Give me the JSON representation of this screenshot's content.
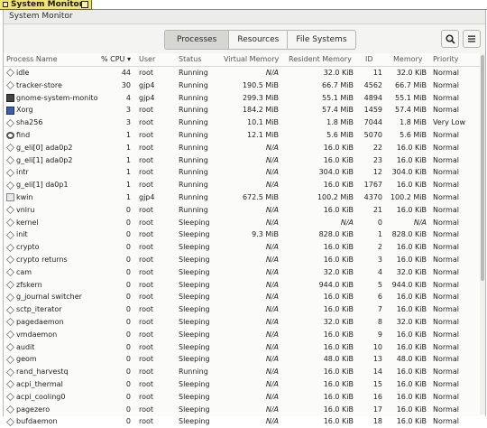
{
  "wm": {
    "title": "System Monitor"
  },
  "window": {
    "title": "System Monitor"
  },
  "tabs": [
    {
      "label": "Processes",
      "active": true
    },
    {
      "label": "Resources",
      "active": false
    },
    {
      "label": "File Systems",
      "active": false
    }
  ],
  "toolbar": {
    "search_icon": "search-icon",
    "menu_icon": "hamburger-menu-icon"
  },
  "columns": {
    "name": "Process Name",
    "cpu": "% CPU",
    "user": "User",
    "status": "Status",
    "vmem": "Virtual Memory",
    "rmem": "Resident Memory",
    "id": "ID",
    "mem": "Memory",
    "prio": "Priority"
  },
  "processes": [
    {
      "icon": "diamond",
      "name": "idle",
      "cpu": "44",
      "user": "root",
      "status": "Running",
      "vmem": "N/A",
      "rmem": "32.0 KiB",
      "id": "11",
      "mem": "32.0 KiB",
      "prio": "Normal"
    },
    {
      "icon": "diamond",
      "name": "tracker-store",
      "cpu": "30",
      "user": "gjp4",
      "status": "Running",
      "vmem": "190.5 MiB",
      "rmem": "66.7 MiB",
      "id": "4562",
      "mem": "66.7 MiB",
      "prio": "Normal"
    },
    {
      "icon": "app",
      "name": "gnome-system-monitor",
      "cpu": "4",
      "user": "gjp4",
      "status": "Running",
      "vmem": "299.3 MiB",
      "rmem": "55.1 MiB",
      "id": "4894",
      "mem": "55.1 MiB",
      "prio": "Normal"
    },
    {
      "icon": "screen",
      "name": "Xorg",
      "cpu": "3",
      "user": "root",
      "status": "Running",
      "vmem": "184.2 MiB",
      "rmem": "57.4 MiB",
      "id": "1459",
      "mem": "57.4 MiB",
      "prio": "Normal"
    },
    {
      "icon": "diamond",
      "name": "sha256",
      "cpu": "3",
      "user": "root",
      "status": "Running",
      "vmem": "10.1 MiB",
      "rmem": "1.8 MiB",
      "id": "7044",
      "mem": "1.8 MiB",
      "prio": "Very Low"
    },
    {
      "icon": "mag",
      "name": "find",
      "cpu": "1",
      "user": "root",
      "status": "Running",
      "vmem": "12.1 MiB",
      "rmem": "5.6 MiB",
      "id": "5070",
      "mem": "5.6 MiB",
      "prio": "Normal"
    },
    {
      "icon": "diamond",
      "name": "g_eli[0] ada0p2",
      "cpu": "1",
      "user": "root",
      "status": "Running",
      "vmem": "N/A",
      "rmem": "16.0 KiB",
      "id": "22",
      "mem": "16.0 KiB",
      "prio": "Normal"
    },
    {
      "icon": "diamond",
      "name": "g_eli[1] ada0p2",
      "cpu": "1",
      "user": "root",
      "status": "Running",
      "vmem": "N/A",
      "rmem": "16.0 KiB",
      "id": "23",
      "mem": "16.0 KiB",
      "prio": "Normal"
    },
    {
      "icon": "diamond",
      "name": "intr",
      "cpu": "1",
      "user": "root",
      "status": "Running",
      "vmem": "N/A",
      "rmem": "304.0 KiB",
      "id": "12",
      "mem": "304.0 KiB",
      "prio": "Normal"
    },
    {
      "icon": "diamond",
      "name": "g_eli[1] da0p1",
      "cpu": "1",
      "user": "root",
      "status": "Running",
      "vmem": "N/A",
      "rmem": "16.0 KiB",
      "id": "1767",
      "mem": "16.0 KiB",
      "prio": "Normal"
    },
    {
      "icon": "kwin",
      "name": "kwin",
      "cpu": "1",
      "user": "gjp4",
      "status": "Running",
      "vmem": "672.5 MiB",
      "rmem": "100.2 MiB",
      "id": "4370",
      "mem": "100.2 MiB",
      "prio": "Normal"
    },
    {
      "icon": "diamond",
      "name": "vnlru",
      "cpu": "0",
      "user": "root",
      "status": "Running",
      "vmem": "N/A",
      "rmem": "16.0 KiB",
      "id": "21",
      "mem": "16.0 KiB",
      "prio": "Normal"
    },
    {
      "icon": "diamond",
      "name": "kernel",
      "cpu": "0",
      "user": "root",
      "status": "Sleeping",
      "vmem": "N/A",
      "rmem": "N/A",
      "id": "0",
      "mem": "N/A",
      "prio": "Normal"
    },
    {
      "icon": "diamond",
      "name": "init",
      "cpu": "0",
      "user": "root",
      "status": "Sleeping",
      "vmem": "9.3 MiB",
      "rmem": "828.0 KiB",
      "id": "1",
      "mem": "828.0 KiB",
      "prio": "Normal"
    },
    {
      "icon": "diamond",
      "name": "crypto",
      "cpu": "0",
      "user": "root",
      "status": "Sleeping",
      "vmem": "N/A",
      "rmem": "16.0 KiB",
      "id": "2",
      "mem": "16.0 KiB",
      "prio": "Normal"
    },
    {
      "icon": "diamond",
      "name": "crypto returns",
      "cpu": "0",
      "user": "root",
      "status": "Sleeping",
      "vmem": "N/A",
      "rmem": "16.0 KiB",
      "id": "3",
      "mem": "16.0 KiB",
      "prio": "Normal"
    },
    {
      "icon": "diamond",
      "name": "cam",
      "cpu": "0",
      "user": "root",
      "status": "Sleeping",
      "vmem": "N/A",
      "rmem": "32.0 KiB",
      "id": "4",
      "mem": "32.0 KiB",
      "prio": "Normal"
    },
    {
      "icon": "diamond",
      "name": "zfskern",
      "cpu": "0",
      "user": "root",
      "status": "Sleeping",
      "vmem": "N/A",
      "rmem": "944.0 KiB",
      "id": "5",
      "mem": "944.0 KiB",
      "prio": "Normal"
    },
    {
      "icon": "diamond",
      "name": "g_journal switcher",
      "cpu": "0",
      "user": "root",
      "status": "Sleeping",
      "vmem": "N/A",
      "rmem": "16.0 KiB",
      "id": "6",
      "mem": "16.0 KiB",
      "prio": "Normal"
    },
    {
      "icon": "diamond",
      "name": "sctp_iterator",
      "cpu": "0",
      "user": "root",
      "status": "Sleeping",
      "vmem": "N/A",
      "rmem": "16.0 KiB",
      "id": "7",
      "mem": "16.0 KiB",
      "prio": "Normal"
    },
    {
      "icon": "diamond",
      "name": "pagedaemon",
      "cpu": "0",
      "user": "root",
      "status": "Sleeping",
      "vmem": "N/A",
      "rmem": "32.0 KiB",
      "id": "8",
      "mem": "32.0 KiB",
      "prio": "Normal"
    },
    {
      "icon": "diamond",
      "name": "vmdaemon",
      "cpu": "0",
      "user": "root",
      "status": "Sleeping",
      "vmem": "N/A",
      "rmem": "16.0 KiB",
      "id": "9",
      "mem": "16.0 KiB",
      "prio": "Normal"
    },
    {
      "icon": "diamond",
      "name": "audit",
      "cpu": "0",
      "user": "root",
      "status": "Sleeping",
      "vmem": "N/A",
      "rmem": "16.0 KiB",
      "id": "10",
      "mem": "16.0 KiB",
      "prio": "Normal"
    },
    {
      "icon": "diamond",
      "name": "geom",
      "cpu": "0",
      "user": "root",
      "status": "Sleeping",
      "vmem": "N/A",
      "rmem": "48.0 KiB",
      "id": "13",
      "mem": "48.0 KiB",
      "prio": "Normal"
    },
    {
      "icon": "diamond",
      "name": "rand_harvestq",
      "cpu": "0",
      "user": "root",
      "status": "Running",
      "vmem": "N/A",
      "rmem": "16.0 KiB",
      "id": "14",
      "mem": "16.0 KiB",
      "prio": "Normal"
    },
    {
      "icon": "diamond",
      "name": "acpi_thermal",
      "cpu": "0",
      "user": "root",
      "status": "Sleeping",
      "vmem": "N/A",
      "rmem": "16.0 KiB",
      "id": "15",
      "mem": "16.0 KiB",
      "prio": "Normal"
    },
    {
      "icon": "diamond",
      "name": "acpi_cooling0",
      "cpu": "0",
      "user": "root",
      "status": "Sleeping",
      "vmem": "N/A",
      "rmem": "16.0 KiB",
      "id": "16",
      "mem": "16.0 KiB",
      "prio": "Normal"
    },
    {
      "icon": "diamond",
      "name": "pagezero",
      "cpu": "0",
      "user": "root",
      "status": "Sleeping",
      "vmem": "N/A",
      "rmem": "16.0 KiB",
      "id": "17",
      "mem": "16.0 KiB",
      "prio": "Normal"
    },
    {
      "icon": "diamond",
      "name": "bufdaemon",
      "cpu": "0",
      "user": "root",
      "status": "Sleeping",
      "vmem": "N/A",
      "rmem": "16.0 KiB",
      "id": "18",
      "mem": "16.0 KiB",
      "prio": "Normal"
    }
  ]
}
